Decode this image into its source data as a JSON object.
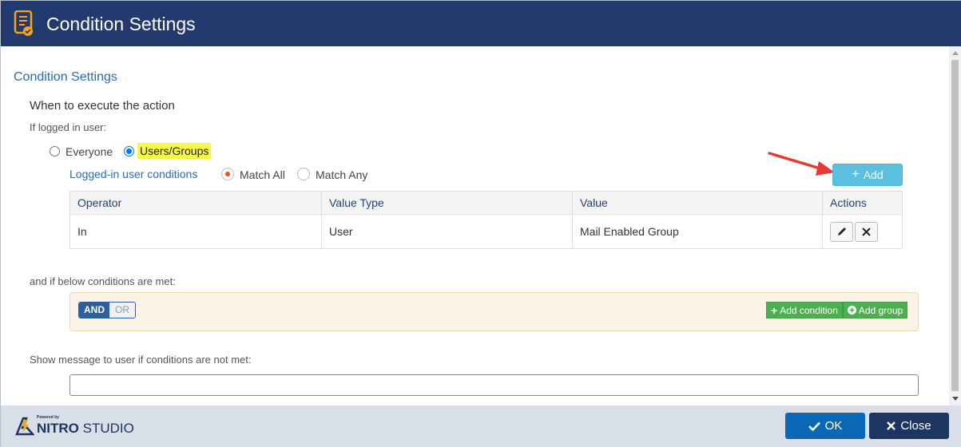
{
  "window": {
    "title": "Condition Settings"
  },
  "section": {
    "title": "Condition Settings",
    "subtitle": "When to execute the action"
  },
  "user_filter": {
    "label": "If logged in user:",
    "options": [
      {
        "label": "Everyone",
        "selected": false
      },
      {
        "label": "Users/Groups",
        "selected": true
      }
    ]
  },
  "user_conditions": {
    "label": "Logged-in user conditions",
    "match_options": [
      {
        "label": "Match All",
        "selected": true
      },
      {
        "label": "Match Any",
        "selected": false
      }
    ],
    "add_label": "Add"
  },
  "table": {
    "headers": [
      "Operator",
      "Value Type",
      "Value",
      "Actions"
    ],
    "rows": [
      {
        "operator": "In",
        "value_type": "User",
        "value": "Mail Enabled Group"
      }
    ]
  },
  "conditions": {
    "label": "and if below conditions are met:",
    "logic": {
      "and": "AND",
      "or": "OR",
      "selected": "AND"
    },
    "add_condition": "Add condition",
    "add_group": "Add group"
  },
  "message": {
    "label": "Show message to user if conditions are not met:",
    "value": ""
  },
  "footer": {
    "powered_by": "Powered by",
    "brand_bold": "NITRO",
    "brand_rest": " STUDIO",
    "ok_label": "OK",
    "close_label": "Close"
  },
  "colors": {
    "titlebar": "#233a6e",
    "accent_blue": "#2b6cb0",
    "add_button": "#5bc0de",
    "green": "#4caf50",
    "ok_button": "#0b68b6",
    "close_button": "#1f3561",
    "highlight": "#f7f74a",
    "arrow": "#e53935"
  }
}
